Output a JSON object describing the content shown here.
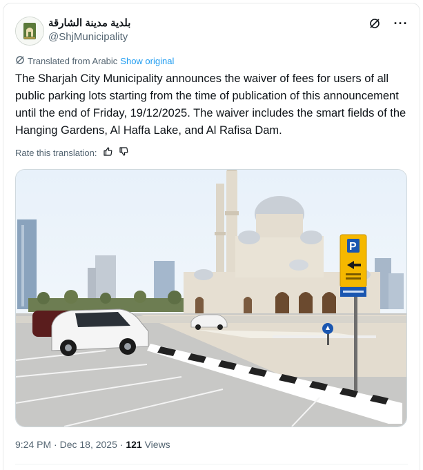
{
  "account": {
    "display_name": "بلدية مدينة الشارقة",
    "handle": "@ShjMunicipality"
  },
  "icons": {
    "grok": "grok-slash-icon",
    "more": "more-dots-icon",
    "translate": "translate-icon",
    "thumb_up": "thumbs-up-icon",
    "thumb_down": "thumbs-down-icon"
  },
  "translation": {
    "label": "Translated from Arabic",
    "show_original": "Show original",
    "rate_label": "Rate this translation:"
  },
  "post": {
    "text": "The Sharjah City Municipality announces the waiver of fees for users of all public parking lots starting from the time of publication of this announcement until the end of Friday, 19/12/2025. The waiver includes the smart fields of the Hanging Gardens, Al Haffa Lake, and Al Rafisa Dam."
  },
  "meta": {
    "time": "9:24 PM",
    "separator": " · ",
    "date": "Dec 18, 2025",
    "views_count": "121",
    "views_label": " Views"
  },
  "colors": {
    "link": "#1d9bf0",
    "secondary_text": "#536471",
    "parking_sign": "#f5b800",
    "parking_sign_blue": "#1a56b0"
  }
}
